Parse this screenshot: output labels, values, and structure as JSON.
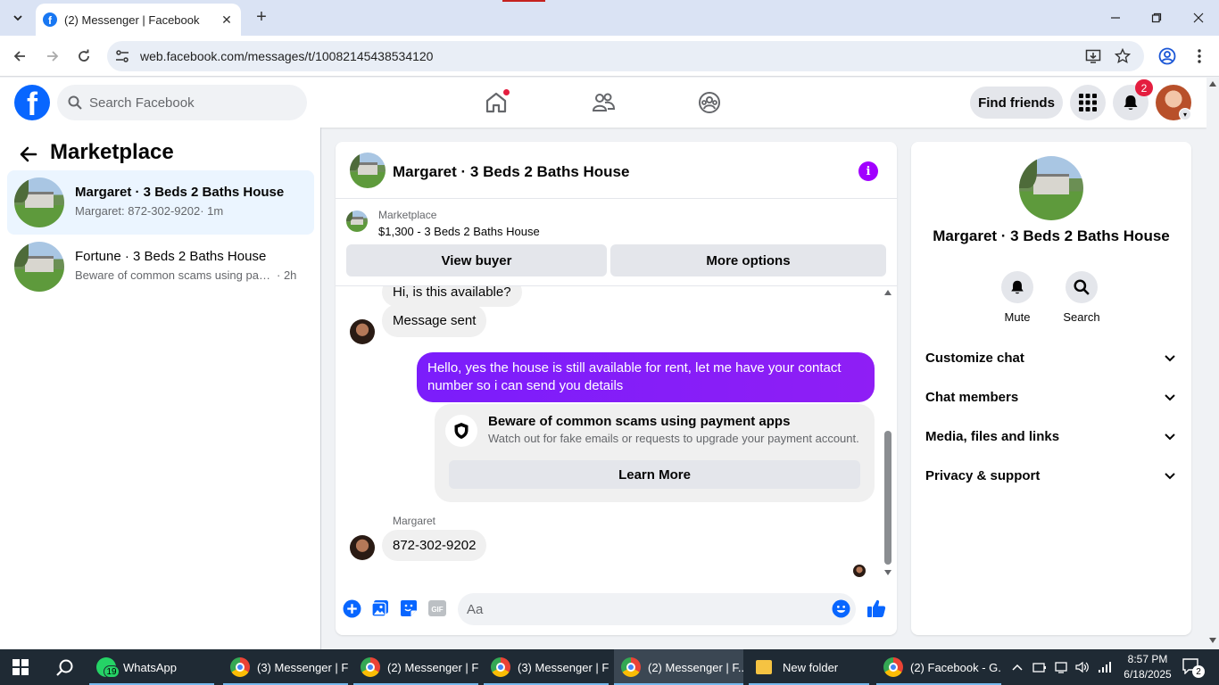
{
  "browser": {
    "tab_title": "(2) Messenger | Facebook",
    "url": "web.facebook.com/messages/t/10082145438534120"
  },
  "fb_header": {
    "search_placeholder": "Search Facebook",
    "find_friends_label": "Find friends",
    "notifications_count": "2",
    "logo_letter": "f"
  },
  "left_panel": {
    "title": "Marketplace",
    "conversations": [
      {
        "name": "Margaret · 3 Beds 2 Baths House",
        "snippet": "Margaret: 872-302-9202",
        "time": "· 1m",
        "active": true
      },
      {
        "name": "Fortune · 3 Beds 2 Baths House",
        "snippet": "Beware of common scams using pay...",
        "time": "· 2h",
        "active": false
      }
    ]
  },
  "chat": {
    "header_name": "Margaret · 3 Beds 2 Baths House",
    "info_icon_glyph": "i",
    "marketplace_label": "Marketplace",
    "listing": "$1,300 - 3 Beds 2 Baths House",
    "view_buyer_label": "View buyer",
    "more_options_label": "More options",
    "messages": {
      "partial": "Hi, is this available?",
      "sent_notice": "Message sent",
      "outgoing": "Hello, yes the house is still available for rent, let me have your contact number so i can send you  details",
      "scam_title": "Beware of common scams using payment apps",
      "scam_text": "Watch out for fake emails or requests to upgrade your payment account.",
      "learn_more_label": "Learn More",
      "sender_label": "Margaret",
      "reply": "872-302-9202"
    },
    "composer_placeholder": "Aa"
  },
  "right_panel": {
    "name": "Margaret · 3 Beds 2 Baths House",
    "actions": [
      {
        "label": "Mute",
        "icon": "bell-icon"
      },
      {
        "label": "Search",
        "icon": "search-icon"
      }
    ],
    "sections": [
      "Customize chat",
      "Chat members",
      "Media, files and links",
      "Privacy & support"
    ]
  },
  "taskbar": {
    "items": [
      {
        "label": "WhatsApp",
        "badge": "19"
      },
      {
        "label": "(3) Messenger | F..."
      },
      {
        "label": "(2) Messenger | F..."
      },
      {
        "label": "(3) Messenger | F..."
      },
      {
        "label": "(2) Messenger | F...",
        "active": true
      },
      {
        "label": "New folder"
      },
      {
        "label": "(2) Facebook - G..."
      }
    ],
    "time": "8:57 PM",
    "date": "6/18/2025",
    "notification_count": "2"
  },
  "colors": {
    "facebook_blue": "#0866ff",
    "messenger_purple": "#8a00ff",
    "active_conversation_bg": "#ebf5ff",
    "badge_red": "#e41e3f",
    "taskbar_bg": "#1f2a34"
  }
}
